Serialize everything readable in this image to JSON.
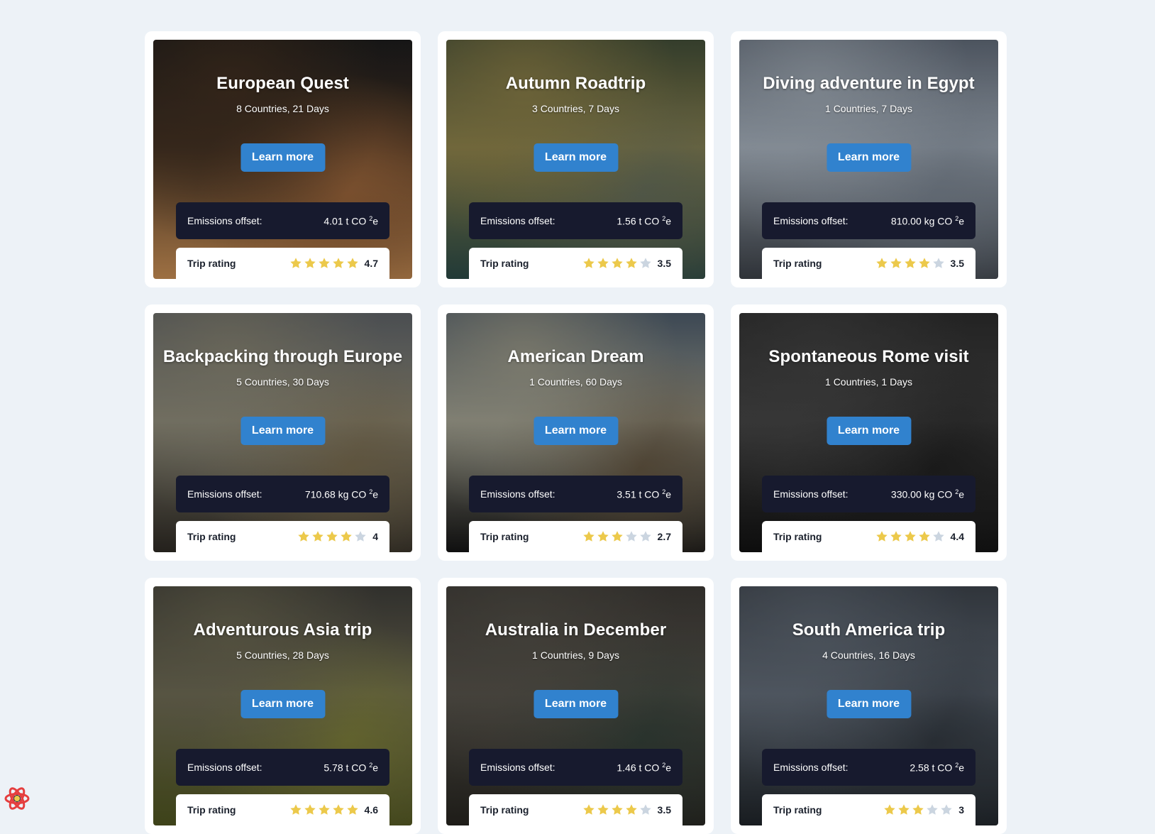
{
  "colors": {
    "page_background": "#edf2f7",
    "button": "#3182ce",
    "emissions_panel": "#171a2e",
    "star_filled": "#ecc94b",
    "star_empty": "#cbd5e0"
  },
  "trips": [
    {
      "title": "European Quest",
      "subtitle": "8 Countries, 21 Days",
      "button_label": "Learn more",
      "emissions_label": "Emissions offset:",
      "emissions_value": "4.01 t CO",
      "emissions_sup": "2",
      "emissions_suffix": "e",
      "rating_label": "Trip rating",
      "rating": 4.7,
      "rating_text": "4.7",
      "stars_filled": 5,
      "photo_colors": [
        "#1b1b1b",
        "#3a2a1d",
        "#8a5a34",
        "#c98f55"
      ]
    },
    {
      "title": "Autumn Roadtrip",
      "subtitle": "3 Countries, 7 Days",
      "button_label": "Learn more",
      "emissions_label": "Emissions offset:",
      "emissions_value": "1.56 t CO",
      "emissions_sup": "2",
      "emissions_suffix": "e",
      "rating_label": "Trip rating",
      "rating": 3.5,
      "rating_text": "3.5",
      "stars_filled": 4,
      "photo_colors": [
        "#3f4a35",
        "#7a7040",
        "#5b6250",
        "#2b4a46"
      ]
    },
    {
      "title": "Diving adventure in Egypt",
      "subtitle": "1 Countries, 7 Days",
      "button_label": "Learn more",
      "emissions_label": "Emissions offset:",
      "emissions_value": "810.00 kg CO",
      "emissions_sup": "2",
      "emissions_suffix": "e",
      "rating_label": "Trip rating",
      "rating": 3.5,
      "rating_text": "3.5",
      "stars_filled": 4,
      "photo_colors": [
        "#5d6673",
        "#8d96a0",
        "#6e7782",
        "#3c4148"
      ]
    },
    {
      "title": "Backpacking through Europe",
      "subtitle": "5 Countries, 30 Days",
      "button_label": "Learn more",
      "emissions_label": "Emissions offset:",
      "emissions_value": "710.68 kg CO",
      "emissions_sup": "2",
      "emissions_suffix": "e",
      "rating_label": "Trip rating",
      "rating": 4,
      "rating_text": "4",
      "stars_filled": 4,
      "photo_colors": [
        "#5b5f63",
        "#7a7768",
        "#6c6047",
        "#2e2a24"
      ]
    },
    {
      "title": "American Dream",
      "subtitle": "1 Countries, 60 Days",
      "button_label": "Learn more",
      "emissions_label": "Emissions offset:",
      "emissions_value": "3.51 t CO",
      "emissions_sup": "2",
      "emissions_suffix": "e",
      "rating_label": "Trip rating",
      "rating": 2.7,
      "rating_text": "2.7",
      "stars_filled": 3,
      "photo_colors": [
        "#4a5866",
        "#8b8a7c",
        "#5a4e3c",
        "#141414"
      ]
    },
    {
      "title": "Spontaneous Rome visit",
      "subtitle": "1 Countries, 1 Days",
      "button_label": "Learn more",
      "emissions_label": "Emissions offset:",
      "emissions_value": "330.00 kg CO",
      "emissions_sup": "2",
      "emissions_suffix": "e",
      "rating_label": "Trip rating",
      "rating": 4.4,
      "rating_text": "4.4",
      "stars_filled": 4,
      "photo_colors": [
        "#2a2a2a",
        "#3b3b3b",
        "#1e1e1e",
        "#111111"
      ]
    },
    {
      "title": "Adventurous Asia trip",
      "subtitle": "5 Countries, 28 Days",
      "button_label": "Learn more",
      "emissions_label": "Emissions offset:",
      "emissions_value": "5.78 t CO",
      "emissions_sup": "2",
      "emissions_suffix": "e",
      "rating_label": "Trip rating",
      "rating": 4.6,
      "rating_text": "4.6",
      "stars_filled": 5,
      "photo_colors": [
        "#3b3a36",
        "#5e5b48",
        "#6f7034",
        "#4f5520"
      ]
    },
    {
      "title": "Australia in December",
      "subtitle": "1 Countries, 9 Days",
      "button_label": "Learn more",
      "emissions_label": "Emissions offset:",
      "emissions_value": "1.46 t CO",
      "emissions_sup": "2",
      "emissions_suffix": "e",
      "rating_label": "Trip rating",
      "rating": 3.5,
      "rating_text": "3.5",
      "stars_filled": 4,
      "photo_colors": [
        "#3a3733",
        "#4a4740",
        "#2f3a33",
        "#26241f"
      ]
    },
    {
      "title": "South America trip",
      "subtitle": "4 Countries, 16 Days",
      "button_label": "Learn more",
      "emissions_label": "Emissions offset:",
      "emissions_value": "2.58 t CO",
      "emissions_sup": "2",
      "emissions_suffix": "e",
      "rating_label": "Trip rating",
      "rating": 3,
      "rating_text": "3",
      "stars_filled": 3,
      "photo_colors": [
        "#3a4048",
        "#545c66",
        "#2e343b",
        "#1f2429"
      ]
    }
  ],
  "devtools_badge": {
    "icon": "react-atom-icon"
  }
}
